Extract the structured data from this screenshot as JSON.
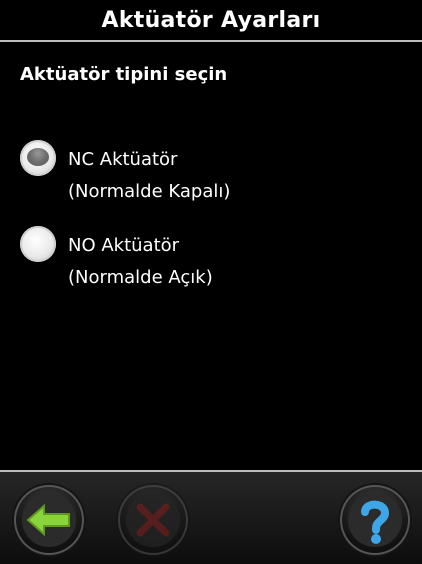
{
  "header": {
    "title": "Aktüatör Ayarları"
  },
  "prompt": "Aktüatör tipini seçin",
  "options": [
    {
      "title": "NC Aktüatör",
      "subtitle": "(Normalde Kapalı)",
      "selected": true
    },
    {
      "title": "NO Aktüatör",
      "subtitle": "(Normalde Açık)",
      "selected": false
    }
  ],
  "footer": {
    "buttons": [
      {
        "name": "back",
        "icon": "arrow-left-icon",
        "enabled": true
      },
      {
        "name": "cancel",
        "icon": "close-icon",
        "enabled": false
      },
      {
        "name": "help",
        "icon": "question-icon",
        "enabled": true
      }
    ]
  },
  "colors": {
    "background": "#000000",
    "text": "#ffffff",
    "accent_green": "#8bd33b",
    "help_blue": "#3ea6e6",
    "cancel_red": "#8b2323"
  }
}
